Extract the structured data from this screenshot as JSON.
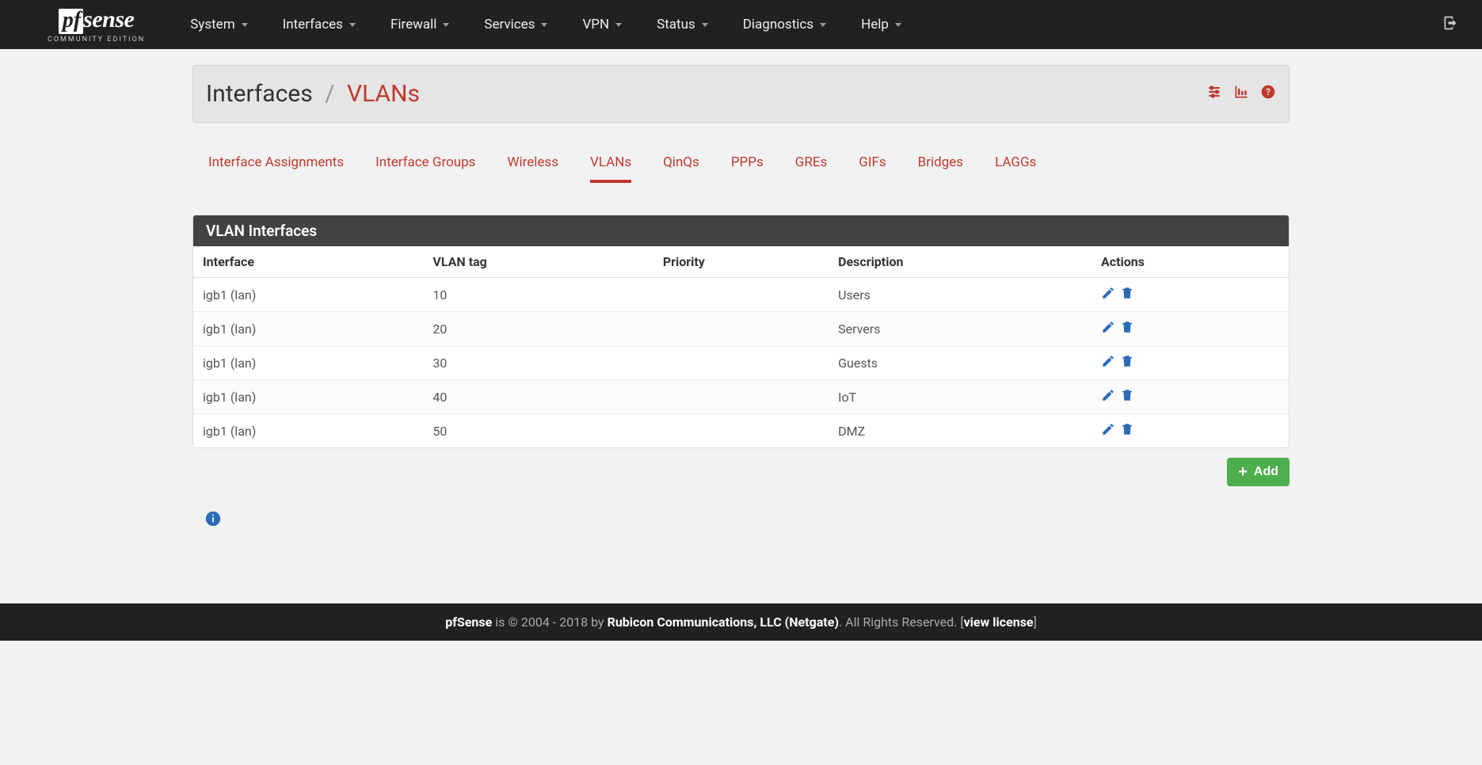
{
  "nav": {
    "items": [
      "System",
      "Interfaces",
      "Firewall",
      "Services",
      "VPN",
      "Status",
      "Diagnostics",
      "Help"
    ],
    "logo_sub": "COMMUNITY EDITION"
  },
  "breadcrumb": {
    "parent": "Interfaces",
    "current": "VLANs"
  },
  "tabs": [
    "Interface Assignments",
    "Interface Groups",
    "Wireless",
    "VLANs",
    "QinQs",
    "PPPs",
    "GREs",
    "GIFs",
    "Bridges",
    "LAGGs"
  ],
  "active_tab": "VLANs",
  "panel_title": "VLAN Interfaces",
  "columns": [
    "Interface",
    "VLAN tag",
    "Priority",
    "Description",
    "Actions"
  ],
  "rows": [
    {
      "interface": "igb1 (lan)",
      "tag": "10",
      "priority": "",
      "description": "Users"
    },
    {
      "interface": "igb1 (lan)",
      "tag": "20",
      "priority": "",
      "description": "Servers"
    },
    {
      "interface": "igb1 (lan)",
      "tag": "30",
      "priority": "",
      "description": "Guests"
    },
    {
      "interface": "igb1 (lan)",
      "tag": "40",
      "priority": "",
      "description": "IoT"
    },
    {
      "interface": "igb1 (lan)",
      "tag": "50",
      "priority": "",
      "description": "DMZ"
    }
  ],
  "add_button": "Add",
  "footer": {
    "product": "pfSense",
    "mid1": " is © 2004 - 2018 by ",
    "company": "Rubicon Communications, LLC (Netgate)",
    "mid2": ". All Rights Reserved. [",
    "link": "view license",
    "mid3": "]"
  }
}
